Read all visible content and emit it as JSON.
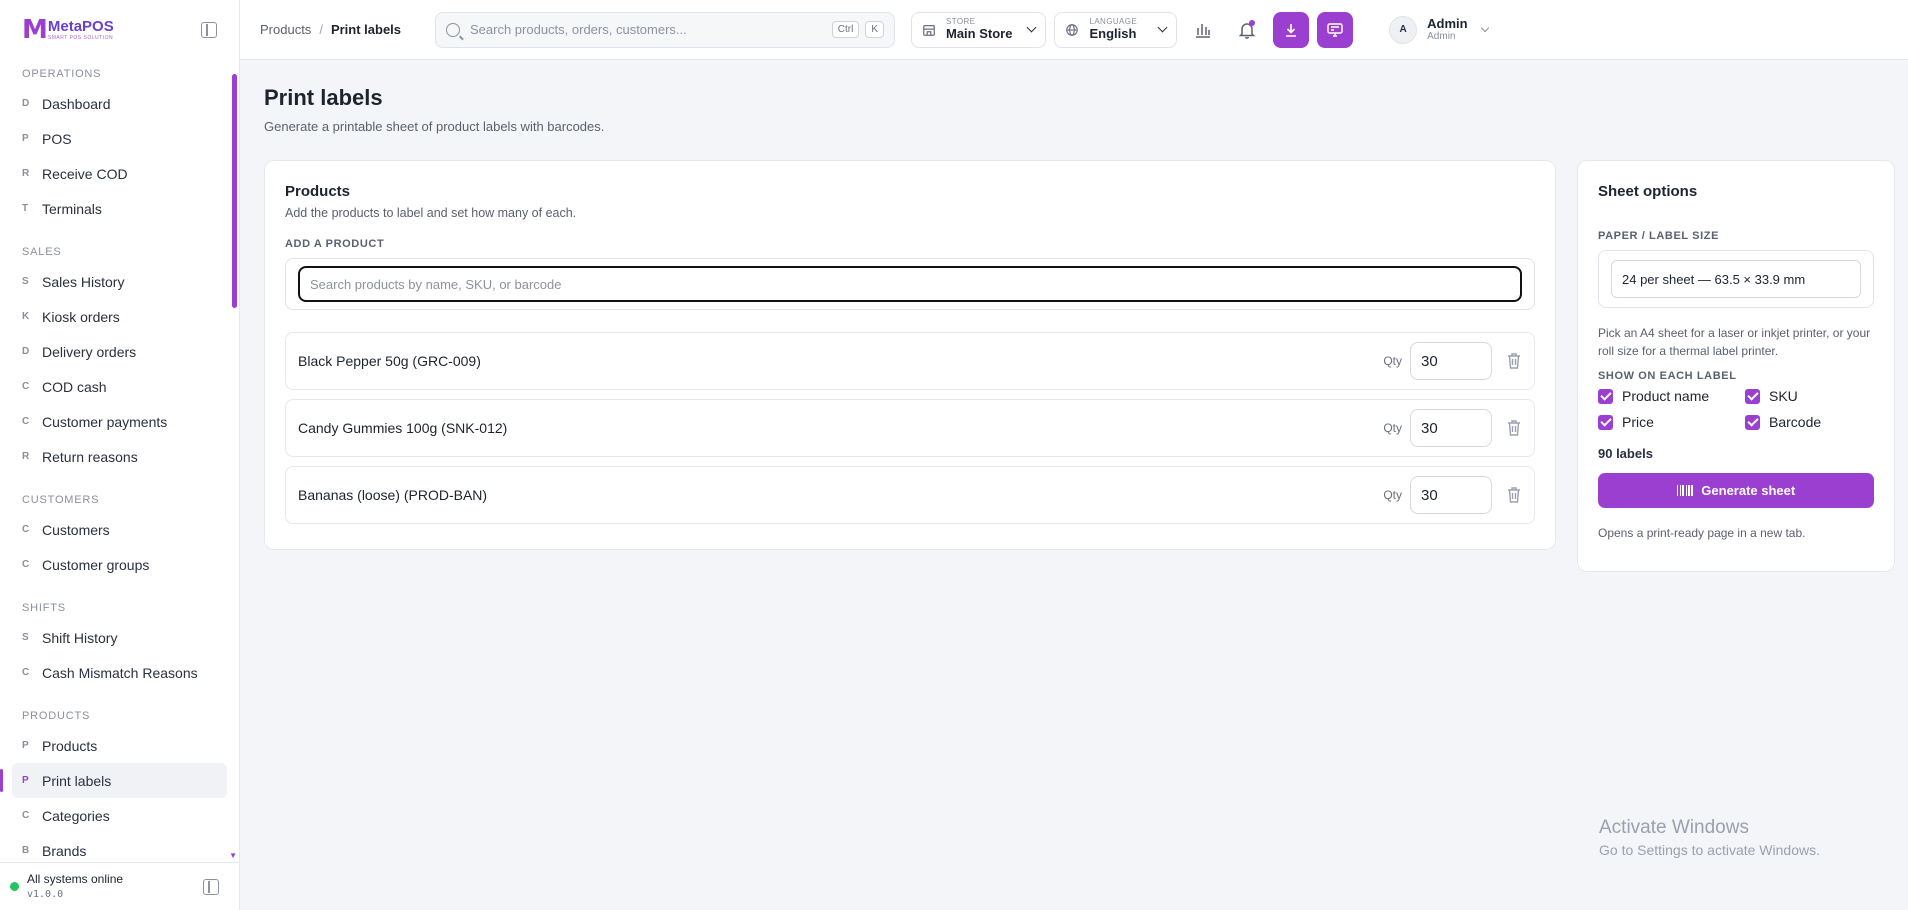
{
  "brand": {
    "name": "MetaPOS",
    "tagline": "SMART POS SOLUTION"
  },
  "sidebar": {
    "sections": [
      {
        "title": "Operations",
        "items": [
          {
            "letter": "D",
            "label": "Dashboard"
          },
          {
            "letter": "P",
            "label": "POS"
          },
          {
            "letter": "R",
            "label": "Receive COD"
          },
          {
            "letter": "T",
            "label": "Terminals"
          }
        ]
      },
      {
        "title": "Sales",
        "items": [
          {
            "letter": "S",
            "label": "Sales History"
          },
          {
            "letter": "K",
            "label": "Kiosk orders"
          },
          {
            "letter": "D",
            "label": "Delivery orders"
          },
          {
            "letter": "C",
            "label": "COD cash"
          },
          {
            "letter": "C",
            "label": "Customer payments"
          },
          {
            "letter": "R",
            "label": "Return reasons"
          }
        ]
      },
      {
        "title": "Customers",
        "items": [
          {
            "letter": "C",
            "label": "Customers"
          },
          {
            "letter": "C",
            "label": "Customer groups"
          }
        ]
      },
      {
        "title": "Shifts",
        "items": [
          {
            "letter": "S",
            "label": "Shift History"
          },
          {
            "letter": "C",
            "label": "Cash Mismatch Reasons"
          }
        ]
      },
      {
        "title": "Products",
        "items": [
          {
            "letter": "P",
            "label": "Products"
          },
          {
            "letter": "P",
            "label": "Print labels",
            "active": true
          },
          {
            "letter": "C",
            "label": "Categories"
          },
          {
            "letter": "B",
            "label": "Brands"
          }
        ]
      }
    ],
    "footer": {
      "status": "All systems online",
      "version": "v1.0.0",
      "status_color": "#22c55e"
    }
  },
  "header": {
    "breadcrumb": {
      "parent": "Products",
      "separator": "/",
      "current": "Print labels"
    },
    "search": {
      "placeholder": "Search products, orders, customers...",
      "kbd1": "Ctrl",
      "kbd2": "K"
    },
    "store": {
      "label": "STORE",
      "value": "Main Store"
    },
    "language": {
      "label": "LANGUAGE",
      "value": "English"
    },
    "user": {
      "initial": "A",
      "name": "Admin",
      "role": "Admin"
    }
  },
  "page": {
    "title": "Print labels",
    "subtitle": "Generate a printable sheet of product labels with barcodes."
  },
  "products_card": {
    "title": "Products",
    "description": "Add the products to label and set how many of each.",
    "add_label": "ADD A PRODUCT",
    "add_placeholder": "Search products by name, SKU, or barcode",
    "qty_label": "Qty",
    "rows": [
      {
        "name": "Black Pepper 50g (GRC-009)",
        "qty": "30"
      },
      {
        "name": "Candy Gummies 100g (SNK-012)",
        "qty": "30"
      },
      {
        "name": "Bananas (loose) (PROD-BAN)",
        "qty": "30"
      }
    ]
  },
  "sheet_card": {
    "title": "Sheet options",
    "paper_label": "PAPER / LABEL SIZE",
    "paper_value": "24 per sheet — 63.5 × 33.9 mm",
    "hint": "Pick an A4 sheet for a laser or inkjet printer, or your roll size for a thermal label printer.",
    "show_label": "SHOW ON EACH LABEL",
    "options": [
      {
        "label": "Product name",
        "checked": true
      },
      {
        "label": "SKU",
        "checked": true
      },
      {
        "label": "Price",
        "checked": true
      },
      {
        "label": "Barcode",
        "checked": true
      }
    ],
    "count": "90 labels",
    "generate_label": "Generate sheet",
    "footnote": "Opens a print-ready page in a new tab."
  },
  "watermark": {
    "title": "Activate Windows",
    "subtitle": "Go to Settings to activate Windows."
  },
  "colors": {
    "accent": "#9a3fcf",
    "background": "#f4f5f8"
  }
}
